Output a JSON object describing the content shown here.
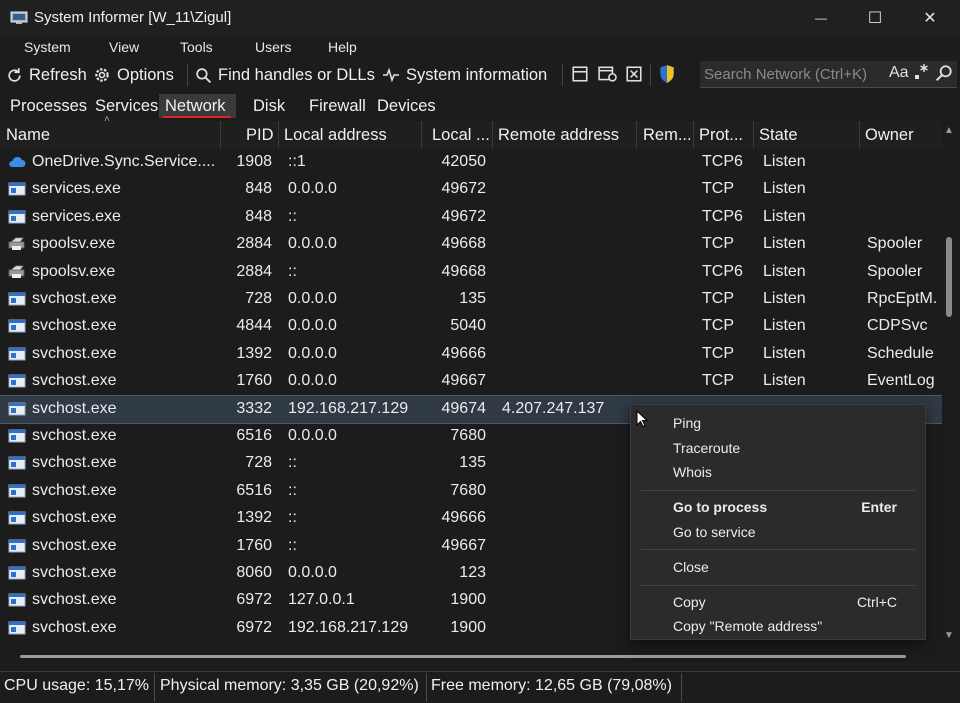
{
  "window": {
    "title": "System Informer [W_11\\Zigul]",
    "controls": {
      "minimize": "—",
      "maximize": "☐",
      "close": "✕"
    }
  },
  "menu": [
    "System",
    "View",
    "Tools",
    "Users",
    "Help"
  ],
  "toolbar": {
    "refresh": "Refresh",
    "options": "Options",
    "find": "Find handles or DLLs",
    "sysinfo": "System information"
  },
  "search": {
    "placeholder": "Search Network (Ctrl+K)",
    "case_label": "Aa"
  },
  "tabs": {
    "items": [
      "Processes",
      "Services",
      "Network",
      "Disk",
      "Firewall",
      "Devices"
    ],
    "active": "Network"
  },
  "columns": [
    "Name",
    "PID",
    "Local address",
    "Local ...",
    "Remote address",
    "Rem...",
    "Prot...",
    "State",
    "Owner"
  ],
  "rows": [
    {
      "name": "OneDrive.Sync.Service....",
      "pid": "1908",
      "local": "::1",
      "lport": "42050",
      "remote": "",
      "proto": "TCP6",
      "state": "Listen",
      "owner": "",
      "icon": "cloud-icon"
    },
    {
      "name": "services.exe",
      "pid": "848",
      "local": "0.0.0.0",
      "lport": "49672",
      "remote": "",
      "proto": "TCP",
      "state": "Listen",
      "owner": "",
      "icon": "app-icon"
    },
    {
      "name": "services.exe",
      "pid": "848",
      "local": "::",
      "lport": "49672",
      "remote": "",
      "proto": "TCP6",
      "state": "Listen",
      "owner": "",
      "icon": "app-icon"
    },
    {
      "name": "spoolsv.exe",
      "pid": "2884",
      "local": "0.0.0.0",
      "lport": "49668",
      "remote": "",
      "proto": "TCP",
      "state": "Listen",
      "owner": "Spooler",
      "icon": "printer-icon"
    },
    {
      "name": "spoolsv.exe",
      "pid": "2884",
      "local": "::",
      "lport": "49668",
      "remote": "",
      "proto": "TCP6",
      "state": "Listen",
      "owner": "Spooler",
      "icon": "printer-icon"
    },
    {
      "name": "svchost.exe",
      "pid": "728",
      "local": "0.0.0.0",
      "lport": "135",
      "remote": "",
      "proto": "TCP",
      "state": "Listen",
      "owner": "RpcEptM.",
      "icon": "app-icon"
    },
    {
      "name": "svchost.exe",
      "pid": "4844",
      "local": "0.0.0.0",
      "lport": "5040",
      "remote": "",
      "proto": "TCP",
      "state": "Listen",
      "owner": "CDPSvc",
      "icon": "app-icon"
    },
    {
      "name": "svchost.exe",
      "pid": "1392",
      "local": "0.0.0.0",
      "lport": "49666",
      "remote": "",
      "proto": "TCP",
      "state": "Listen",
      "owner": "Schedule",
      "icon": "app-icon"
    },
    {
      "name": "svchost.exe",
      "pid": "1760",
      "local": "0.0.0.0",
      "lport": "49667",
      "remote": "",
      "proto": "TCP",
      "state": "Listen",
      "owner": "EventLog",
      "icon": "app-icon"
    },
    {
      "name": "svchost.exe",
      "pid": "3332",
      "local": "192.168.217.129",
      "lport": "49674",
      "remote": "4.207.247.137",
      "proto": "",
      "state": "",
      "owner": "",
      "icon": "app-icon",
      "selected": true
    },
    {
      "name": "svchost.exe",
      "pid": "6516",
      "local": "0.0.0.0",
      "lport": "7680",
      "remote": "",
      "proto": "",
      "state": "",
      "owner": "",
      "icon": "app-icon"
    },
    {
      "name": "svchost.exe",
      "pid": "728",
      "local": "::",
      "lport": "135",
      "remote": "",
      "proto": "",
      "state": "",
      "owner": "",
      "icon": "app-icon"
    },
    {
      "name": "svchost.exe",
      "pid": "6516",
      "local": "::",
      "lport": "7680",
      "remote": "",
      "proto": "",
      "state": "",
      "owner": "",
      "icon": "app-icon"
    },
    {
      "name": "svchost.exe",
      "pid": "1392",
      "local": "::",
      "lport": "49666",
      "remote": "",
      "proto": "",
      "state": "",
      "owner": "",
      "icon": "app-icon"
    },
    {
      "name": "svchost.exe",
      "pid": "1760",
      "local": "::",
      "lport": "49667",
      "remote": "",
      "proto": "",
      "state": "",
      "owner": "",
      "icon": "app-icon"
    },
    {
      "name": "svchost.exe",
      "pid": "8060",
      "local": "0.0.0.0",
      "lport": "123",
      "remote": "",
      "proto": "",
      "state": "",
      "owner": "",
      "icon": "app-icon"
    },
    {
      "name": "svchost.exe",
      "pid": "6972",
      "local": "127.0.0.1",
      "lport": "1900",
      "remote": "",
      "proto": "",
      "state": "",
      "owner": "",
      "icon": "app-icon"
    },
    {
      "name": "svchost.exe",
      "pid": "6972",
      "local": "192.168.217.129",
      "lport": "1900",
      "remote": "",
      "proto": "",
      "state": "",
      "owner": "",
      "icon": "app-icon"
    }
  ],
  "context_menu": {
    "ping": "Ping",
    "traceroute": "Traceroute",
    "whois": "Whois",
    "goto_process": "Go to process",
    "goto_process_shortcut": "Enter",
    "goto_service": "Go to service",
    "close": "Close",
    "copy": "Copy",
    "copy_shortcut": "Ctrl+C",
    "copy_remote": "Copy \"Remote address\""
  },
  "status": {
    "cpu": "CPU usage: 15,17%",
    "physical": "Physical memory: 3,35 GB (20,92%)",
    "free": "Free memory: 12,65 GB (79,08%)"
  },
  "colors": {
    "accent": "#e0202a",
    "background": "#1c1c1c",
    "selection": "#2f3a45"
  }
}
